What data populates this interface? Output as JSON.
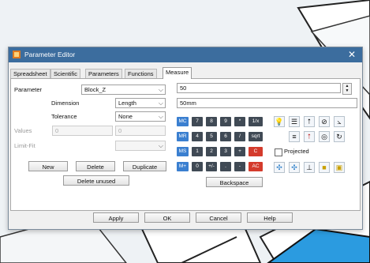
{
  "dialog": {
    "title": "Parameter Editor",
    "close_glyph": "✕"
  },
  "tabs": [
    "Spreadsheet",
    "Scientific",
    "Parameters",
    "Functions",
    "Measure"
  ],
  "form": {
    "parameter_label": "Parameter",
    "parameter_value": "Block_Z",
    "dimension_label": "Dimension",
    "dimension_value": "Length",
    "tolerance_label": "Tolerance",
    "tolerance_value": "None",
    "values_label": "Values",
    "values_min": "0",
    "values_max": "0",
    "limitfit_label": "Limit-Fit",
    "limitfit_value": ""
  },
  "buttons": {
    "new": "New",
    "delete": "Delete",
    "duplicate": "Duplicate",
    "delete_unused": "Delete unused",
    "backspace": "Backspace",
    "apply": "Apply",
    "ok": "OK",
    "cancel": "Cancel",
    "help": "Help"
  },
  "expression": {
    "value": "50",
    "result": "50mm"
  },
  "calculator": {
    "row1": [
      "MC",
      "7",
      "8",
      "9",
      "*",
      "1/x"
    ],
    "row2": [
      "MR",
      "4",
      "5",
      "6",
      "/",
      "sqrt"
    ],
    "row3": [
      "MS",
      "1",
      "2",
      "3",
      "+",
      "C"
    ],
    "row4": [
      "M+",
      "0",
      "+/-",
      ".",
      "-",
      "AC"
    ]
  },
  "measure_tools": {
    "projected_label": "Projected",
    "icons": [
      "lightbulb-icon",
      "parallel-lines-icon",
      "vertical-arrow-icon",
      "angle-circle-icon",
      "angle-icon",
      "horizontal-measure-icon",
      "red-arrow-icon",
      "circle-icon",
      "radius-circle-icon",
      "cross-arrows-icon",
      "cross-arrows-2-icon",
      "thickness-icon",
      "solid-icon",
      "volume-icon"
    ]
  },
  "colors": {
    "titlebar": "#3c6d9e",
    "memory_key": "#3a7fd0",
    "number_key": "#404a55",
    "clear_key": "#d43b2c"
  }
}
